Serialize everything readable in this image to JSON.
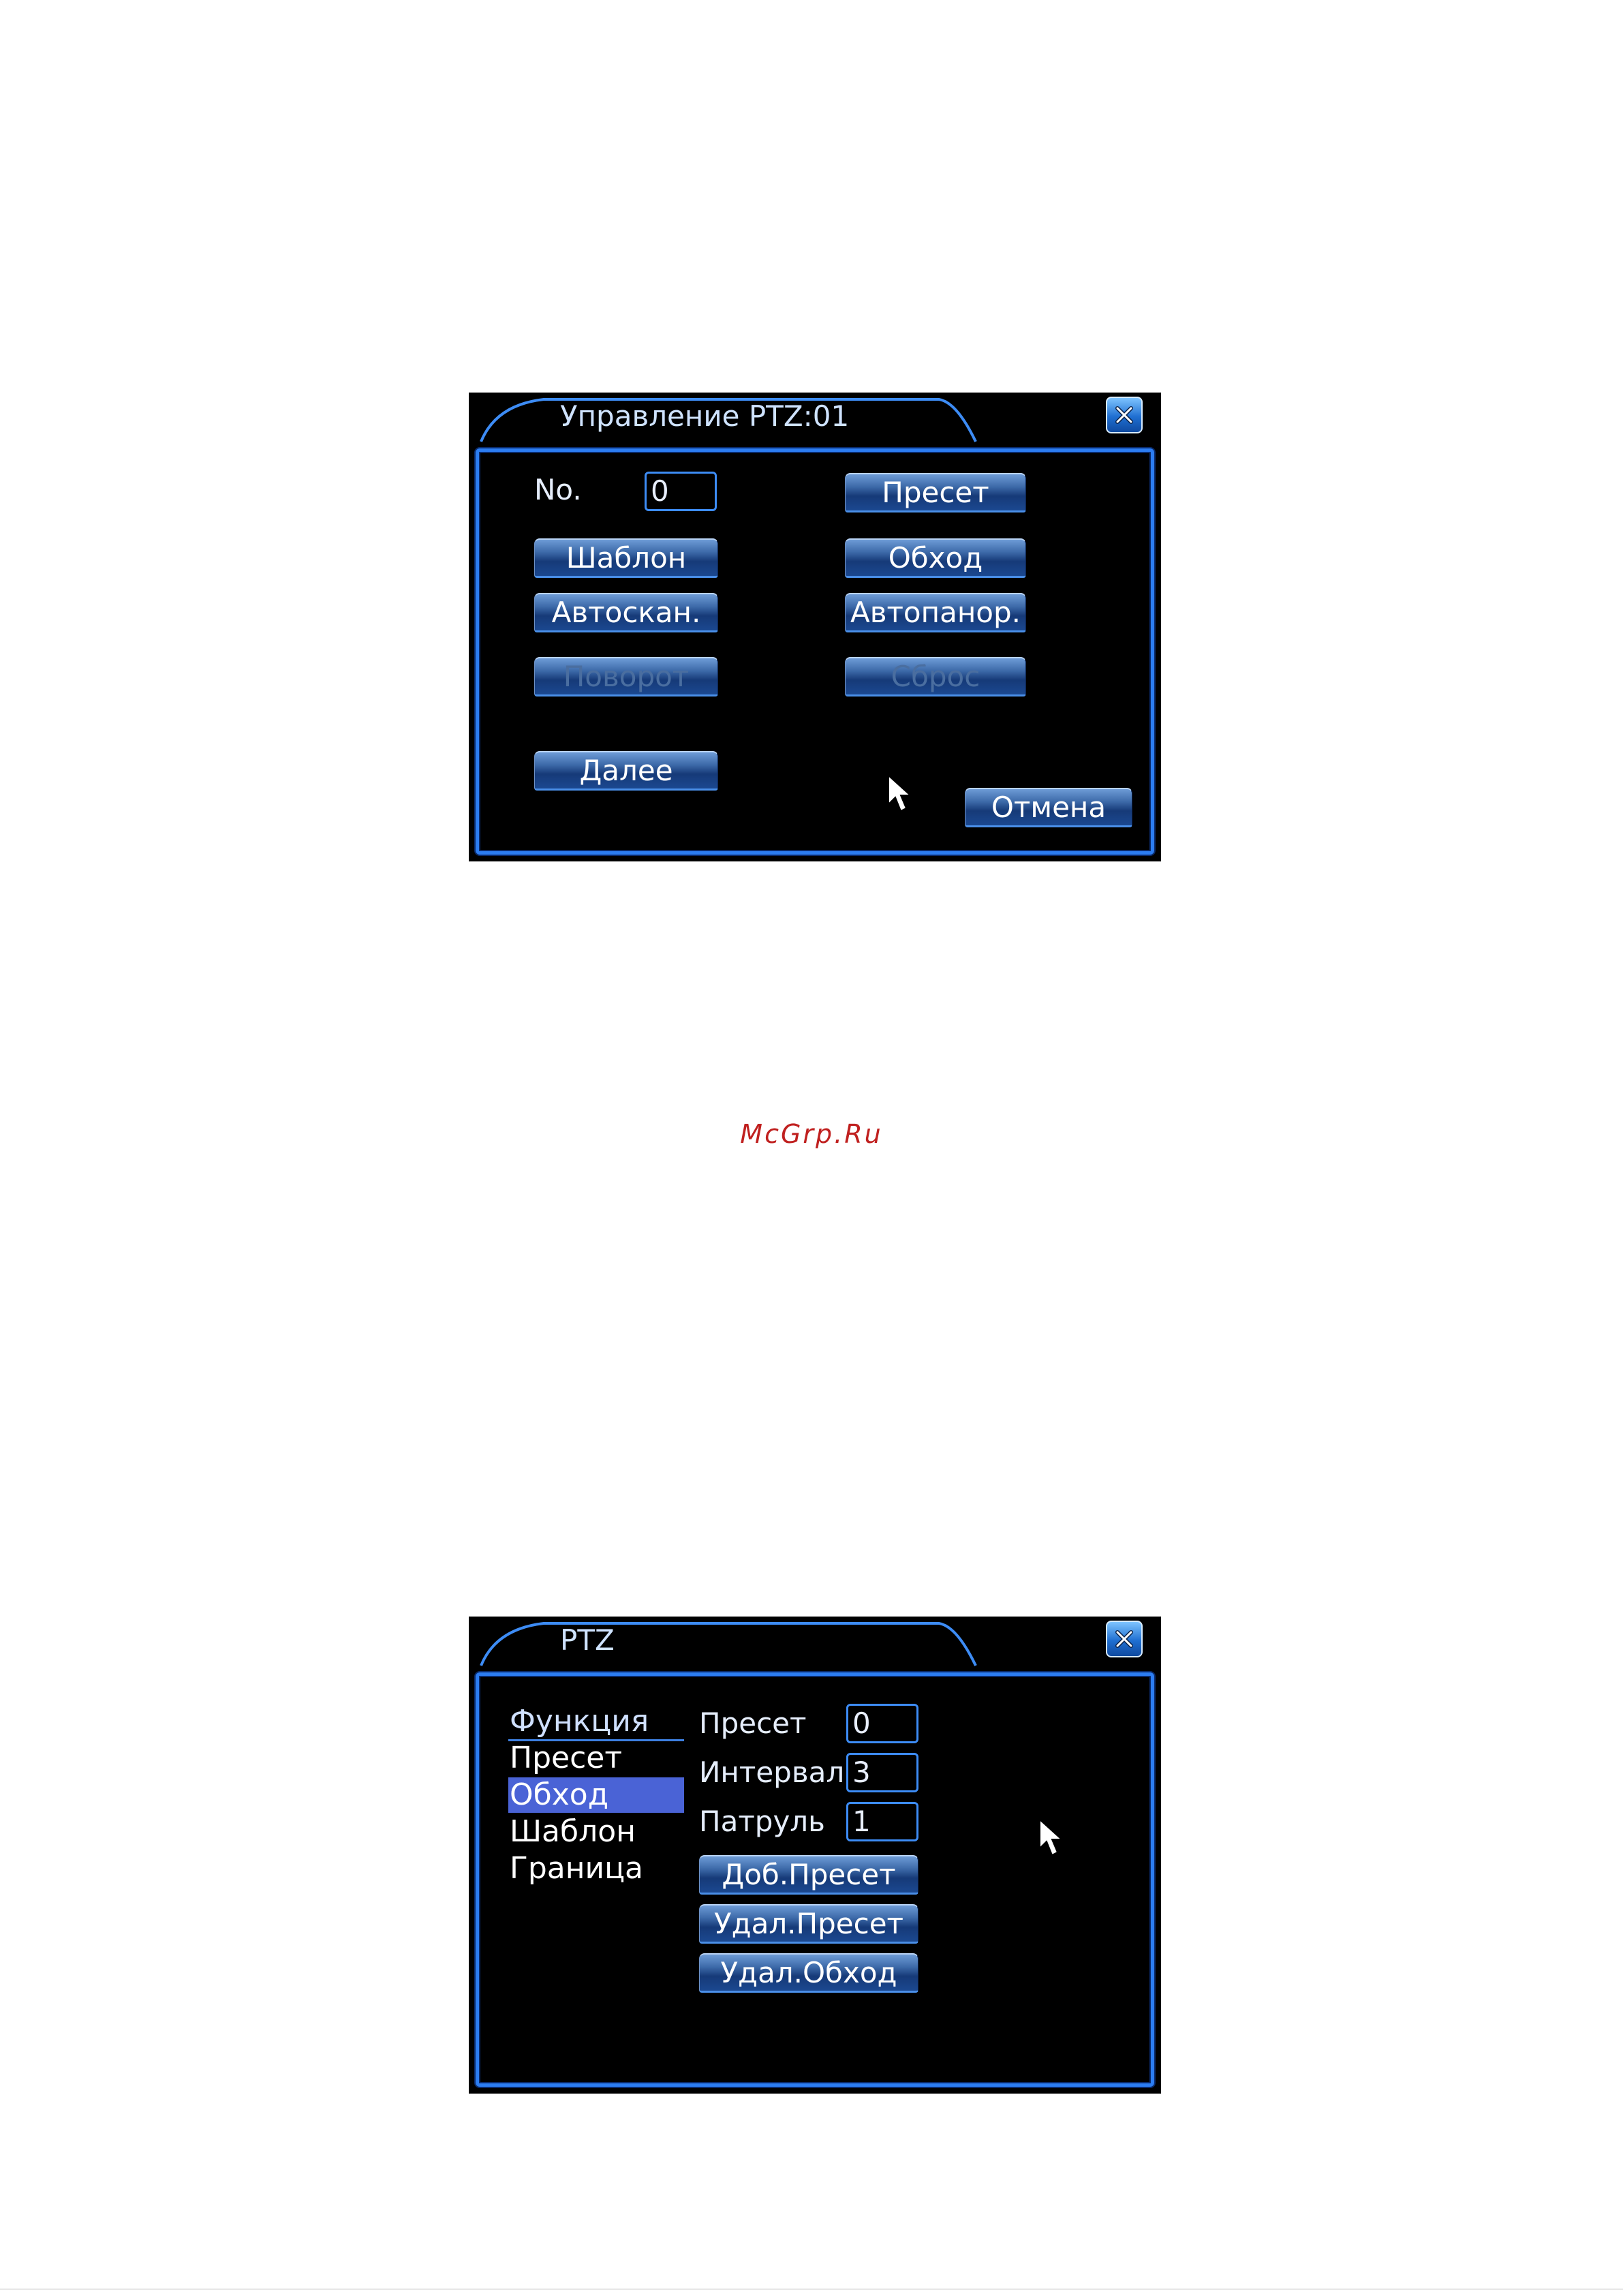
{
  "dialog1": {
    "title": "Управление PTZ:01",
    "no_label": "No.",
    "no_value": "0",
    "buttons": {
      "preset": "Пресет",
      "template": "Шаблон",
      "tour": "Обход",
      "autoscan": "Автоскан.",
      "autopan": "Автопанор.",
      "rotate": "Поворот",
      "reset": "Сброс",
      "next": "Далее",
      "cancel": "Отмена"
    }
  },
  "watermark": "McGrp.Ru",
  "dialog2": {
    "title": "PTZ",
    "menu": {
      "header": "Функция",
      "items": [
        "Пресет",
        "Обход",
        "Шаблон",
        "Граница"
      ],
      "selected_index": 1
    },
    "fields": {
      "preset_label": "Пресет",
      "preset_value": "0",
      "interval_label": "Интервал",
      "interval_value": "3",
      "patrol_label": "Патруль",
      "patrol_value": "1"
    },
    "buttons": {
      "add_preset": "Доб.Пресет",
      "del_preset": "Удал.Пресет",
      "del_tour": "Удал.Обход"
    }
  },
  "colors": {
    "accent": "#2c7df2",
    "selection": "#4a63d6",
    "watermark": "#c0201f"
  }
}
